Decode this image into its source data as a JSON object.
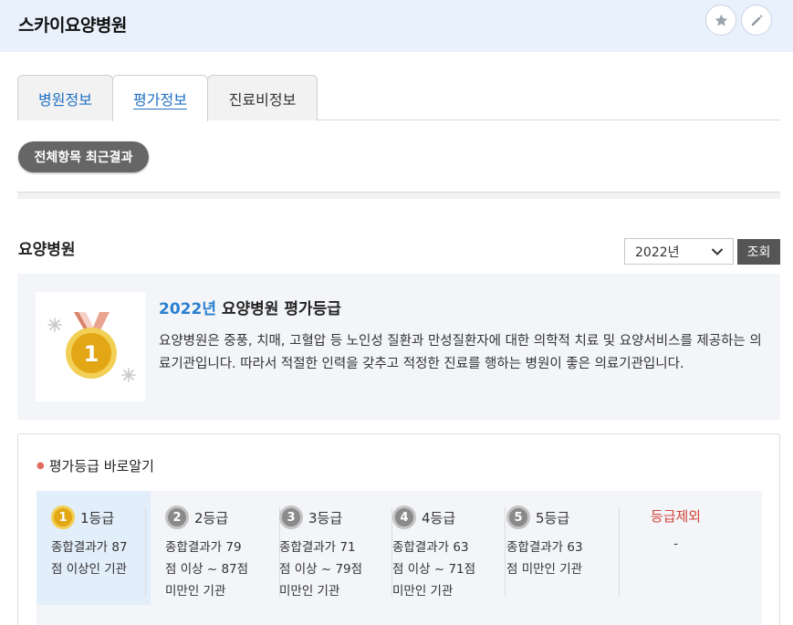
{
  "header": {
    "hospital_name": "스카이요양병원",
    "favorite_icon": "star-icon",
    "edit_icon": "pencil-icon",
    "bg_color": "#e9f2fc"
  },
  "tabs": [
    {
      "label": "병원정보",
      "active": false
    },
    {
      "label": "평가정보",
      "active": true
    },
    {
      "label": "진료비정보",
      "active": false
    }
  ],
  "filter_pill": {
    "label": "전체항목 최근결과"
  },
  "section": {
    "title": "요양병원",
    "year_select": {
      "selected": "2022년",
      "options": [
        "2022년"
      ]
    },
    "query_button": "조회"
  },
  "grade_summary": {
    "year": "2022년",
    "title": " 요양병원 평가등급",
    "description": "요양병원은 중풍, 치매, 고혈압 등 노인성 질환과 만성질환자에 대한 의학적 치료 및 요양서비스를 제공하는 의료기관입니다. 따라서 적절한 인력을 갖추고 적정한 진료를 행하는 병원이 좋은 의료기관입니다.",
    "medal_number": "1",
    "accent_color": "#2a7fd0"
  },
  "guide": {
    "title": "평가등급 바로알기",
    "grades": [
      {
        "number": "1",
        "label": "1등급",
        "desc": [
          "종합결과가 87",
          "점 이상인 기관"
        ],
        "highlight": true
      },
      {
        "number": "2",
        "label": "2등급",
        "desc": [
          "종합결과가 79",
          "점 이상 ~ 87점",
          "미만인 기관"
        ],
        "highlight": false
      },
      {
        "number": "3",
        "label": "3등급",
        "desc": [
          "종합결과가 71",
          "점 이상 ~ 79점",
          "미만인 기관"
        ],
        "highlight": false
      },
      {
        "number": "4",
        "label": "4등급",
        "desc": [
          "종합결과가 63",
          "점 이상 ~ 71점",
          "미만인 기관"
        ],
        "highlight": false
      },
      {
        "number": "5",
        "label": "5등급",
        "desc": [
          "종합결과가 63",
          "점 미만인 기관"
        ],
        "highlight": false
      }
    ],
    "excluded": {
      "label": "등급제외",
      "desc": "-",
      "color": "#d3443a"
    }
  }
}
